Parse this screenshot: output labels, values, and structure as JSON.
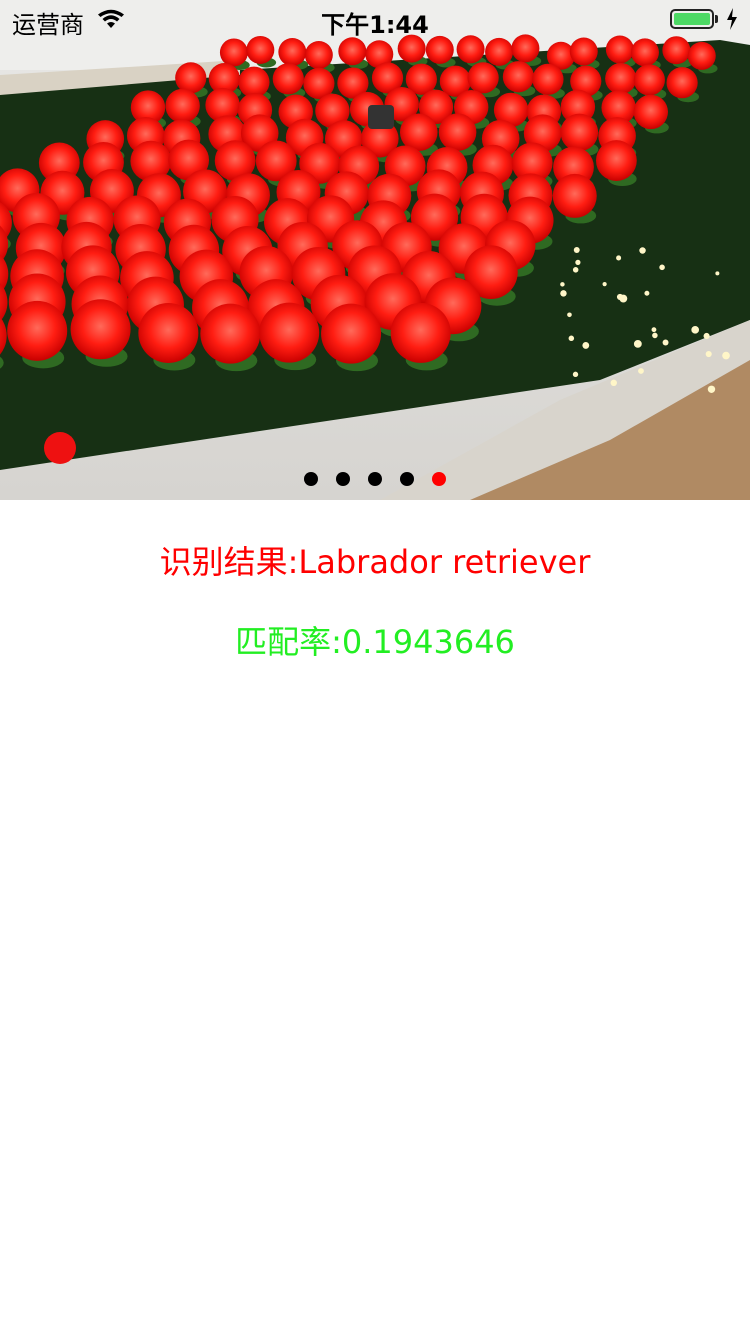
{
  "status_bar": {
    "carrier": "运营商",
    "time": "下午1:44",
    "battery_level": 1.0,
    "charging": true,
    "icons": [
      "wifi-icon",
      "battery-icon",
      "charging-bolt-icon"
    ]
  },
  "carousel": {
    "image_subject": "red rose display",
    "page_count": 5,
    "current_page": 5,
    "dot_color": "#000000",
    "active_dot_color": "#ff0000"
  },
  "result": {
    "recognition_text": "识别结果:Labrador retriever",
    "recognition_color": "#ff0000",
    "match_text": "匹配率:0.1943646",
    "match_color": "#22ee22"
  }
}
